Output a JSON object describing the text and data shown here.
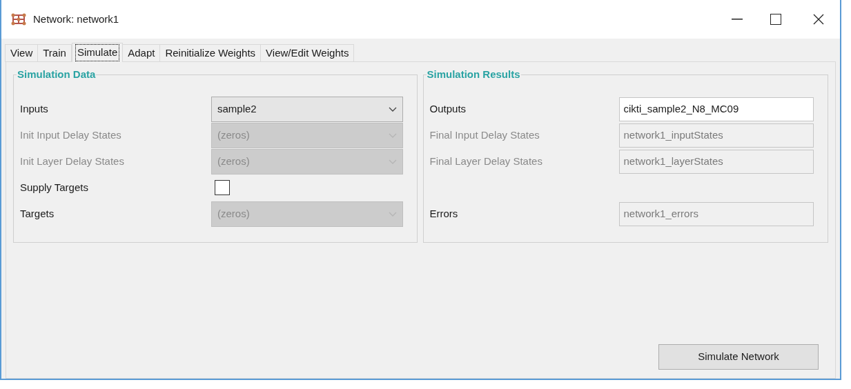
{
  "window": {
    "title": "Network: network1"
  },
  "tabs": [
    {
      "label": "View",
      "selected": false
    },
    {
      "label": "Train",
      "selected": false
    },
    {
      "label": "Simulate",
      "selected": true
    },
    {
      "label": "Adapt",
      "selected": false
    },
    {
      "label": "Reinitialize Weights",
      "selected": false
    },
    {
      "label": "View/Edit Weights",
      "selected": false
    }
  ],
  "groups": [
    {
      "title": "Simulation Data",
      "rows": [
        {
          "kind": "combo",
          "label": "Inputs",
          "label_greyed": false,
          "value": "sample2",
          "disabled": false
        },
        {
          "kind": "combo",
          "label": "Init Input Delay States",
          "label_greyed": true,
          "value": "(zeros)",
          "disabled": true
        },
        {
          "kind": "combo",
          "label": "Init Layer Delay States",
          "label_greyed": true,
          "value": "(zeros)",
          "disabled": true
        },
        {
          "kind": "checkbox",
          "label": "Supply Targets",
          "label_greyed": false,
          "checked": false
        },
        {
          "kind": "combo",
          "label": "Targets",
          "label_greyed": false,
          "value": "(zeros)",
          "disabled": true
        }
      ]
    },
    {
      "title": "Simulation Results",
      "rows": [
        {
          "kind": "text",
          "label": "Outputs",
          "label_greyed": false,
          "value": "cikti_sample2_N8_MC09",
          "disabled": false
        },
        {
          "kind": "text",
          "label": "Final Input Delay States",
          "label_greyed": true,
          "value": "network1_inputStates",
          "disabled": true
        },
        {
          "kind": "text",
          "label": "Final Layer Delay States",
          "label_greyed": true,
          "value": "network1_layerStates",
          "disabled": true
        },
        {
          "kind": "text",
          "label": "Errors",
          "label_greyed": false,
          "value": "network1_errors",
          "disabled": true
        }
      ]
    }
  ],
  "button": "Simulate Network"
}
